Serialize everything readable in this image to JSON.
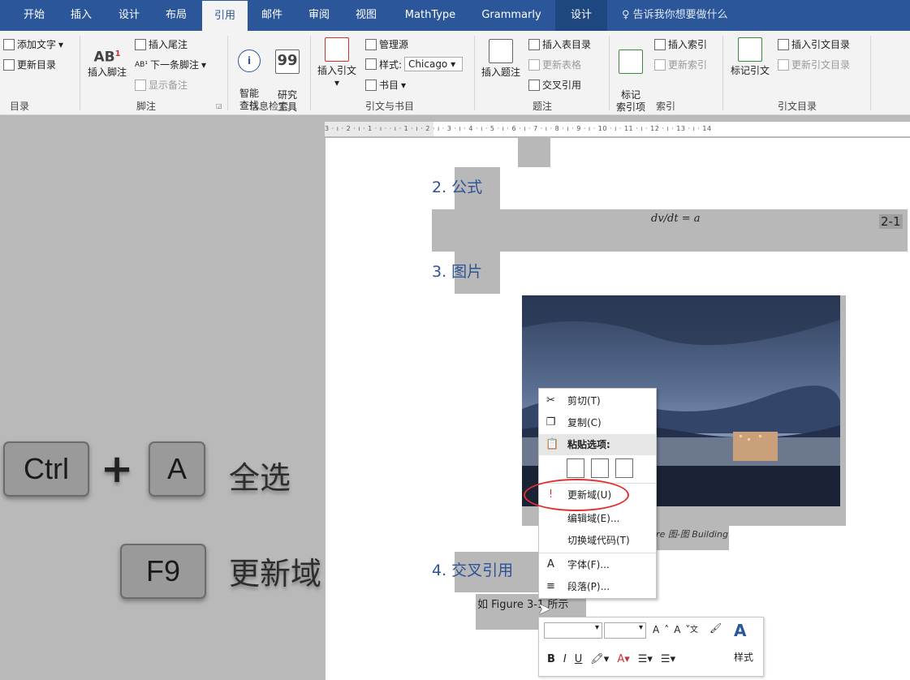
{
  "tabs": [
    "开始",
    "插入",
    "设计",
    "布局",
    "引用",
    "邮件",
    "审阅",
    "视图",
    "MathType",
    "Grammarly",
    "设计"
  ],
  "tell_me": "告诉我你想要做什么",
  "ribbon": {
    "toc": {
      "add_text": "添加文字",
      "update_toc": "更新目录",
      "label": "目录"
    },
    "footnotes": {
      "insert_endnote": "插入尾注",
      "insert_footnote": "插入脚注",
      "next_footnote": "下一条脚注",
      "show_notes": "显示备注",
      "label": "脚注"
    },
    "research": {
      "smart_lookup": "智能\n查找",
      "researcher": "研究\n工具",
      "label": "信息检索"
    },
    "citations": {
      "insert_citation": "插入引文",
      "manage_sources": "管理源",
      "style_label": "样式:",
      "style_value": "Chicago",
      "bibliography": "书目",
      "label": "引文与书目"
    },
    "captions": {
      "insert_caption": "插入题注",
      "insert_table_of_figures": "插入表目录",
      "update_table": "更新表格",
      "cross_reference": "交叉引用",
      "label": "题注"
    },
    "index": {
      "mark_entry": "标记\n索引项",
      "insert_index": "插入索引",
      "update_index": "更新索引",
      "label": "索引"
    },
    "toa": {
      "mark_citation": "标记引文",
      "insert_toa": "插入引文目录",
      "update_toa": "更新引文目录",
      "label": "引文目录"
    }
  },
  "ruler_text": "3 · ı · 2 · ı · 1 · ı ·   · ı · 1 · ı · 2 · ı · 3 · ı · 4 · ı · 5 · ı · 6 · ı · 7 · ı · 8 · ı · 9 · ı · 10 · ı · 11 · ı · 12 · ı · 13 · ı · 14",
  "document": {
    "h2": "2. 公式",
    "equation": "dv/dt = a",
    "eq_num": "2-1",
    "h3": "3. 图片",
    "caption": "ire 图-图 Building",
    "h4": "4. 交叉引用",
    "crossref_text": "如 Figure 3-1 所示"
  },
  "context_menu": {
    "cut": "剪切(T)",
    "copy": "复制(C)",
    "paste_options": "粘贴选项:",
    "update_field": "更新域(U)",
    "edit_field": "编辑域(E)...",
    "toggle_codes": "切换域代码(T)",
    "font": "字体(F)...",
    "paragraph": "段落(P)..."
  },
  "minibar": {
    "styles": "样式"
  },
  "shortcuts": {
    "ctrl": "Ctrl",
    "plus": "+",
    "a": "A",
    "select_all": "全选",
    "f9": "F9",
    "update_fields": "更新域"
  },
  "colors": {
    "tabbar": "#2b579a",
    "heading": "#2e5395",
    "highlight": "#e03030"
  }
}
